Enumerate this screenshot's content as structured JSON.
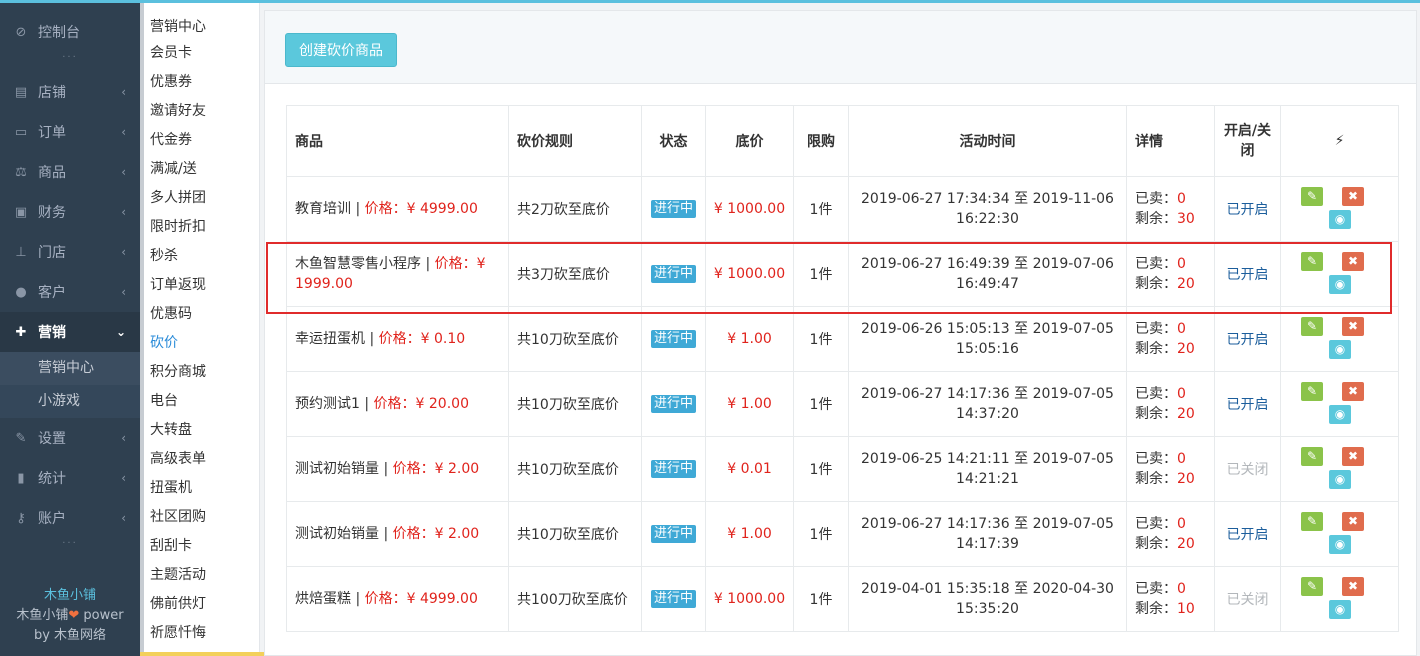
{
  "sidebar": {
    "items": [
      {
        "label": "控制台",
        "icon": "dashboard-icon"
      },
      {
        "label": "店铺",
        "icon": "store-icon"
      },
      {
        "label": "订单",
        "icon": "order-icon"
      },
      {
        "label": "商品",
        "icon": "scale-icon"
      },
      {
        "label": "财务",
        "icon": "finance-icon"
      },
      {
        "label": "门店",
        "icon": "sitemap-icon"
      },
      {
        "label": "客户",
        "icon": "users-icon"
      },
      {
        "label": "营销",
        "icon": "gift-icon"
      },
      {
        "label": "设置",
        "icon": "wrench-icon"
      },
      {
        "label": "统计",
        "icon": "signal-icon"
      },
      {
        "label": "账户",
        "icon": "key-icon"
      }
    ],
    "marketing_sub": [
      "营销中心",
      "小游戏"
    ],
    "footer": {
      "brand": "木鱼小铺",
      "power_prefix": "木鱼小铺",
      "power_suffix": " power",
      "by": "by 木鱼网络"
    }
  },
  "submenu": [
    "营销中心",
    "会员卡",
    "优惠券",
    "邀请好友",
    "代金券",
    "满减/送",
    "多人拼团",
    "限时折扣",
    "秒杀",
    "订单返现",
    "优惠码",
    "砍价",
    "积分商城",
    "电台",
    "大转盘",
    "高级表单",
    "扭蛋机",
    "社区团购",
    "刮刮卡",
    "主题活动",
    "佛前供灯",
    "祈愿忏悔"
  ],
  "toolbar": {
    "create_label": "创建砍价商品"
  },
  "table": {
    "headers": {
      "goods": "商品",
      "rule": "砍价规则",
      "status": "状态",
      "low": "底价",
      "limit": "限购",
      "time": "活动时间",
      "detail": "详情",
      "toggle": "开启/关闭",
      "ops": "⚡"
    },
    "sold_label": "已卖：",
    "remain_label": "剩余：",
    "rows": [
      {
        "name": "教育培训",
        "price": "价格：¥ 4999.00",
        "rule": "共2刀砍至底价",
        "status": "进行中",
        "low": "¥ 1000.00",
        "limit": "1件",
        "time": "2019-06-27 17:34:34 至 2019-11-06 16:22:30",
        "sold": "0",
        "remain": "30",
        "switch": "已开启",
        "on": true
      },
      {
        "name": "木鱼智慧零售小程序",
        "price": "价格：¥ 1999.00",
        "rule": "共3刀砍至底价",
        "status": "进行中",
        "low": "¥ 1000.00",
        "limit": "1件",
        "time": "2019-06-27 16:49:39 至 2019-07-06 16:49:47",
        "sold": "0",
        "remain": "20",
        "switch": "已开启",
        "on": true
      },
      {
        "name": "幸运扭蛋机",
        "price": "价格：¥ 0.10",
        "rule": "共10刀砍至底价",
        "status": "进行中",
        "low": "¥ 1.00",
        "limit": "1件",
        "time": "2019-06-26 15:05:13 至 2019-07-05 15:05:16",
        "sold": "0",
        "remain": "20",
        "switch": "已开启",
        "on": true
      },
      {
        "name": "预约测试1",
        "price": "价格：¥ 20.00",
        "rule": "共10刀砍至底价",
        "status": "进行中",
        "low": "¥ 1.00",
        "limit": "1件",
        "time": "2019-06-27 14:17:36 至 2019-07-05 14:37:20",
        "sold": "0",
        "remain": "20",
        "switch": "已开启",
        "on": true
      },
      {
        "name": "测试初始销量",
        "price": "价格：¥ 2.00",
        "rule": "共10刀砍至底价",
        "status": "进行中",
        "low": "¥ 0.01",
        "limit": "1件",
        "time": "2019-06-25 14:21:11 至 2019-07-05 14:21:21",
        "sold": "0",
        "remain": "20",
        "switch": "已关闭",
        "on": false
      },
      {
        "name": "测试初始销量",
        "price": "价格：¥ 2.00",
        "rule": "共10刀砍至底价",
        "status": "进行中",
        "low": "¥ 1.00",
        "limit": "1件",
        "time": "2019-06-27 14:17:36 至 2019-07-05 14:17:39",
        "sold": "0",
        "remain": "20",
        "switch": "已开启",
        "on": true
      },
      {
        "name": "烘焙蛋糕",
        "price": "价格：¥ 4999.00",
        "rule": "共100刀砍至底价",
        "status": "进行中",
        "low": "¥ 1000.00",
        "limit": "1件",
        "time": "2019-04-01 15:35:18 至 2020-04-30 15:35:20",
        "sold": "0",
        "remain": "10",
        "switch": "已关闭",
        "on": false
      }
    ]
  },
  "colors": {
    "sidebar_bg": "#2f4050",
    "accent": "#5bc8dc",
    "price_red": "#e0231c",
    "badge_blue": "#3fa9d6",
    "highlight": "#e02b2b"
  }
}
